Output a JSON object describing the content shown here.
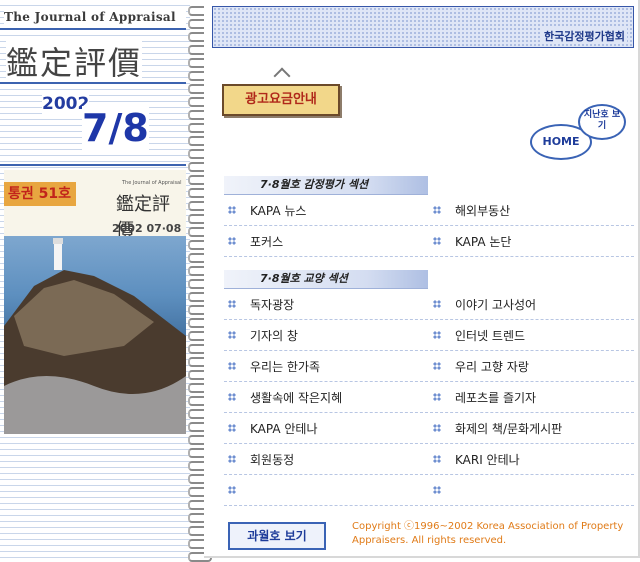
{
  "left": {
    "journal": "The Journal of Appraisal",
    "title_cn": "鑑定評價",
    "year": "2002",
    "issue": "7/8",
    "cover": {
      "badge": "통권 51호",
      "mini_title": "The Journal of Appraisal",
      "mini_cn": "鑑定評價",
      "date": "2002 07·08"
    }
  },
  "banner": {
    "org": "한국감정평가협회"
  },
  "ad_sign": "광고요금안내",
  "buttons": {
    "home": "HOME",
    "past": "지난호 보기",
    "past_issue": "과월호 보기"
  },
  "sections": [
    {
      "heading": "7·8월호 감정평가 섹션",
      "rows": [
        [
          "KAPA 뉴스",
          "해외부동산"
        ],
        [
          "포커스",
          "KAPA 논단"
        ]
      ]
    },
    {
      "heading": "7·8월호 교양 섹션",
      "rows": [
        [
          "독자광장",
          "이야기 고사성어"
        ],
        [
          "기자의 창",
          "인터넷 트렌드"
        ],
        [
          "우리는 한가족",
          "우리 고향 자랑"
        ],
        [
          "생활속에 작은지혜",
          "레포츠를 즐기자"
        ],
        [
          "KAPA 안테나",
          "화제의 책/문화게시판"
        ],
        [
          "회원동정",
          "KARI 안테나"
        ],
        [
          "",
          ""
        ]
      ]
    }
  ],
  "copyright": "Copyright ⓒ1996~2002 Korea Association of Property Appraisers. All rights reserved."
}
